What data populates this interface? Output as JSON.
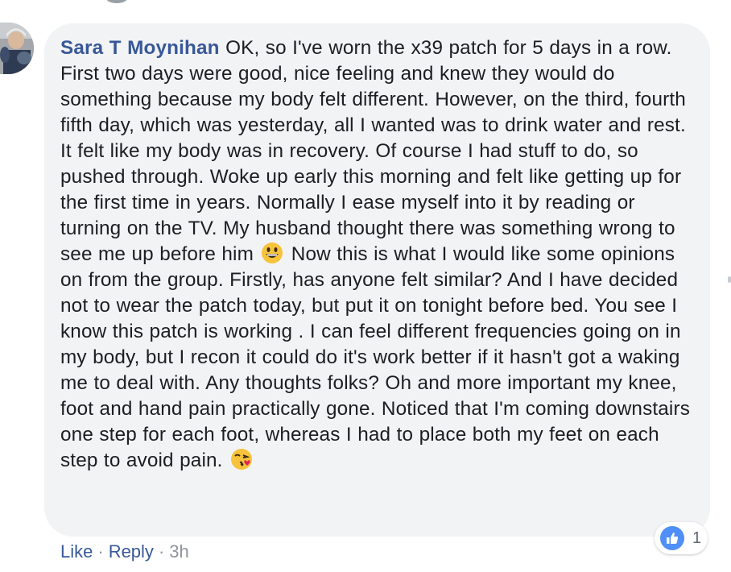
{
  "comment": {
    "author": "Sara T Moynihan",
    "text_part1": " OK, so I've worn the x39 patch for 5 days in a row. First two days were good, nice feeling and knew they would do something because my body felt different. However, on the third, fourth fifth day, which was yesterday, all I wanted was to drink water and rest. It felt like my body was in recovery. Of course I had stuff to do, so pushed through. Woke up early this morning and felt like getting up for the first time in years. Normally I ease myself into it by reading or turning on the TV. My husband thought there was something wrong to see me up before him ",
    "emoji1": "grinning-face-emoji",
    "text_part2": " Now this is what I would like some opinions on from the group. Firstly, has anyone felt similar? And I have decided not to wear the patch today, but put it on tonight before bed. You see I know this patch is working . I can feel different frequencies going on in my body, but I recon it could do it's work better if it hasn't got a waking me to deal with. Any thoughts folks? Oh and more important my knee, foot and hand pain practically gone. Noticed that I'm coming downstairs one step for each foot, whereas I had to place both my feet on each step to avoid pain. ",
    "emoji2": "face-blowing-kiss-emoji"
  },
  "reactions": {
    "icon": "thumbs-up-icon",
    "count": "1"
  },
  "actions": {
    "like": "Like",
    "separator": "·",
    "reply": "Reply",
    "time": "3h"
  },
  "colors": {
    "author": "#385898",
    "bubble": "#f2f3f5",
    "text": "#1c1e21",
    "meta": "#90949c",
    "like_badge": "#4f8ff7"
  }
}
